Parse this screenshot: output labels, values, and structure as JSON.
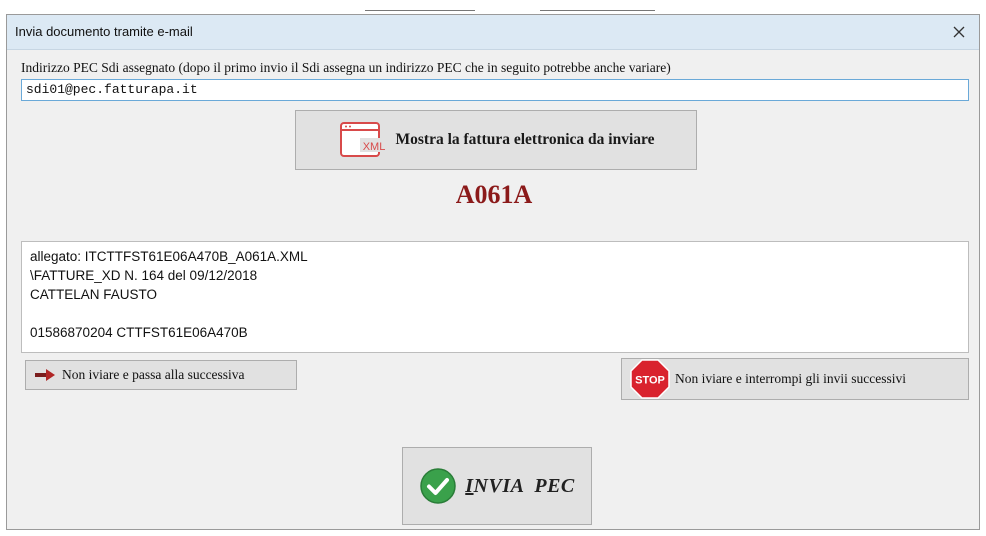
{
  "window": {
    "title": "Invia documento tramite e-mail"
  },
  "pec": {
    "label": "Indirizzo PEC Sdi assegnato (dopo il primo invio il Sdi assegna un indirizzo PEC che in seguito potrebbe anche variare)",
    "value": "sdi01@pec.fatturapa.it"
  },
  "show_button": {
    "icon_text": "XML",
    "label": "Mostra la fattura elettronica da inviare"
  },
  "document_code": "A061A",
  "info_lines": [
    "allegato: ITCTTFST61E06A470B_A061A.XML",
    "\\FATTURE_XD N. 164 del 09/12/2018",
    "CATTELAN FAUSTO",
    "",
    "01586870204 CTTFST61E06A470B"
  ],
  "skip_button": {
    "label": "Non iviare e passa alla successiva"
  },
  "stop_button": {
    "icon_text": "STOP",
    "label": "Non iviare e interrompi gli invii successivi"
  },
  "send_button": {
    "label_underlined": "I",
    "label_rest": "NVIA  PEC"
  },
  "colors": {
    "titlebar": "#dce9f4",
    "document_code": "#8b1a1a",
    "stop_red": "#d9232e",
    "check_green": "#3aa14b"
  }
}
